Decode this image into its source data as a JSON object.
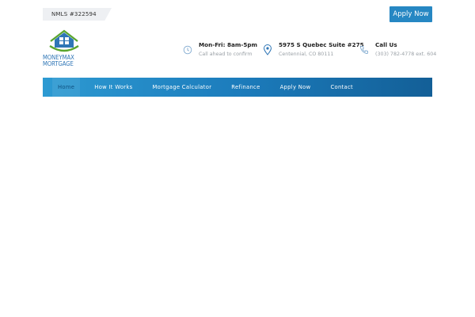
{
  "topbar": {
    "nmls_label": "NMLS #322594",
    "apply_button": "Apply Now"
  },
  "logo": {
    "line1": "MONEYMAX",
    "line2": "MORTGAGE"
  },
  "contact_info": [
    {
      "title": "Mon-Fri: 8am-5pm",
      "subtitle": "Call ahead to confirm",
      "icon": "clock-icon"
    },
    {
      "title": "5975 S Quebec Suite #275",
      "subtitle": "Centennial, CO 80111",
      "icon": "location-pin-icon"
    },
    {
      "title": "Call Us",
      "subtitle": "(303) 782-4778 ext. 604",
      "icon": "phone-icon"
    }
  ],
  "nav": {
    "items": [
      {
        "label": "Home",
        "active": true
      },
      {
        "label": "How It Works"
      },
      {
        "label": "Mortgage Calculator"
      },
      {
        "label": "Refinance"
      },
      {
        "label": "Apply Now"
      },
      {
        "label": "Contact"
      }
    ]
  },
  "colors": {
    "brand_blue": "#2687c3",
    "logo_green": "#5aa52d",
    "nav_gradient_start": "#2d9ad2",
    "nav_gradient_end": "#135f97"
  }
}
